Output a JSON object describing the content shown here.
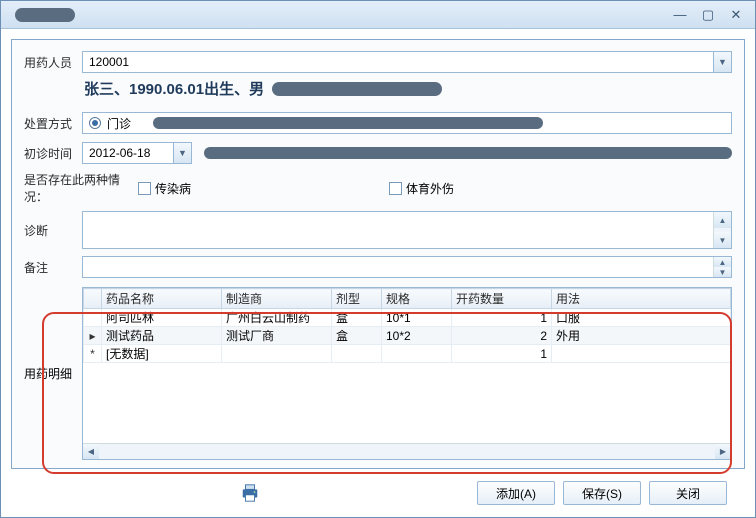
{
  "window": {
    "minimize": "—",
    "maximize": "▢",
    "close": "✕"
  },
  "labels": {
    "patient": "用药人员",
    "disposition": "处置方式",
    "firstVisit": "初诊时间",
    "conditions": "是否存在此两种情况：",
    "infectious": "传染病",
    "sportsInjury": "体育外伤",
    "diagnosis": "诊断",
    "remarks": "备注",
    "detail": "用药明细"
  },
  "patient": {
    "id": "120001",
    "summary": "张三、1990.06.01出生、男"
  },
  "disposition": {
    "selected": "门诊"
  },
  "firstVisit": {
    "date": "2012-06-18"
  },
  "grid": {
    "headers": {
      "name": "药品名称",
      "manufacturer": "制造商",
      "form": "剂型",
      "spec": "规格",
      "qty": "开药数量",
      "usage": "用法"
    },
    "rows": [
      {
        "marker": "",
        "name": "阿司匹林",
        "manufacturer": "广州白云山制药",
        "form": "盒",
        "spec": "10*1",
        "qty": "1",
        "usage": "口服"
      },
      {
        "marker": "▸",
        "name": "测试药品",
        "manufacturer": "测试厂商",
        "form": "盒",
        "spec": "10*2",
        "qty": "2",
        "usage": "外用"
      },
      {
        "marker": "*",
        "name": "[无数据]",
        "manufacturer": "",
        "form": "",
        "spec": "",
        "qty": "1",
        "usage": ""
      }
    ]
  },
  "buttons": {
    "add": "添加(A)",
    "save": "保存(S)",
    "close": "关闭"
  },
  "glyphs": {
    "dropdown": "▼",
    "up": "▲",
    "down": "▼",
    "left": "◀",
    "right": "▶"
  }
}
